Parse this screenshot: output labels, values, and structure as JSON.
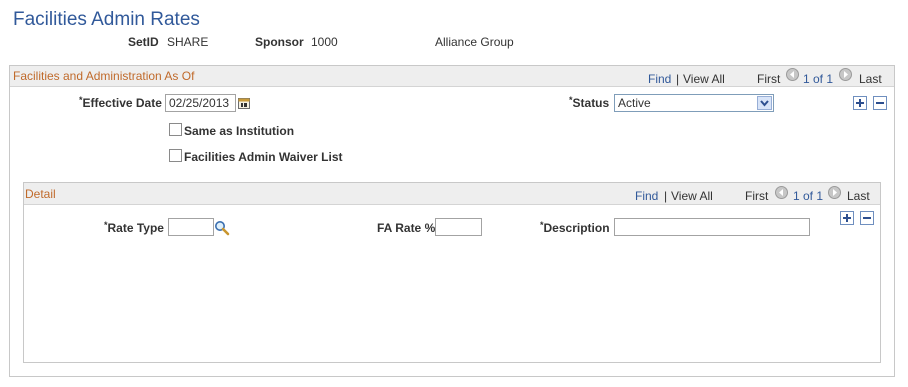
{
  "page": {
    "title": "Facilities Admin Rates"
  },
  "header": {
    "setid_label": "SetID",
    "setid_value": "SHARE",
    "sponsor_label": "Sponsor",
    "sponsor_value": "1000",
    "sponsor_name": "Alliance Group"
  },
  "fa_group": {
    "title": "Facilities and Administration As Of",
    "find": "Find",
    "view_all": "View All",
    "first": "First",
    "count": "1 of 1",
    "last": "Last",
    "effective_date_label": "Effective Date",
    "effective_date_value": "02/25/2013",
    "status_label": "Status",
    "status_value": "Active",
    "same_as_institution_label": "Same as Institution",
    "same_as_institution_checked": false,
    "waiver_list_label": "Facilities Admin Waiver List",
    "waiver_list_checked": false
  },
  "detail": {
    "title": "Detail",
    "find": "Find",
    "view_all": "View All",
    "first": "First",
    "count": "1 of 1",
    "last": "Last",
    "rate_type_label": "Rate Type",
    "rate_type_value": "",
    "fa_rate_label": "FA Rate %",
    "fa_rate_value": "",
    "description_label": "Description",
    "description_value": ""
  },
  "required_marker": "*",
  "separator": "|",
  "icons": {
    "calendar": "calendar-icon",
    "lookup": "lookup-icon",
    "prev": "previous-icon",
    "next": "next-icon",
    "add": "add-row-icon",
    "delete": "delete-row-icon",
    "dropdown": "chevron-down-icon"
  },
  "colors": {
    "title": "#31599a",
    "group_title": "#c06a2b",
    "link": "#31599a"
  }
}
